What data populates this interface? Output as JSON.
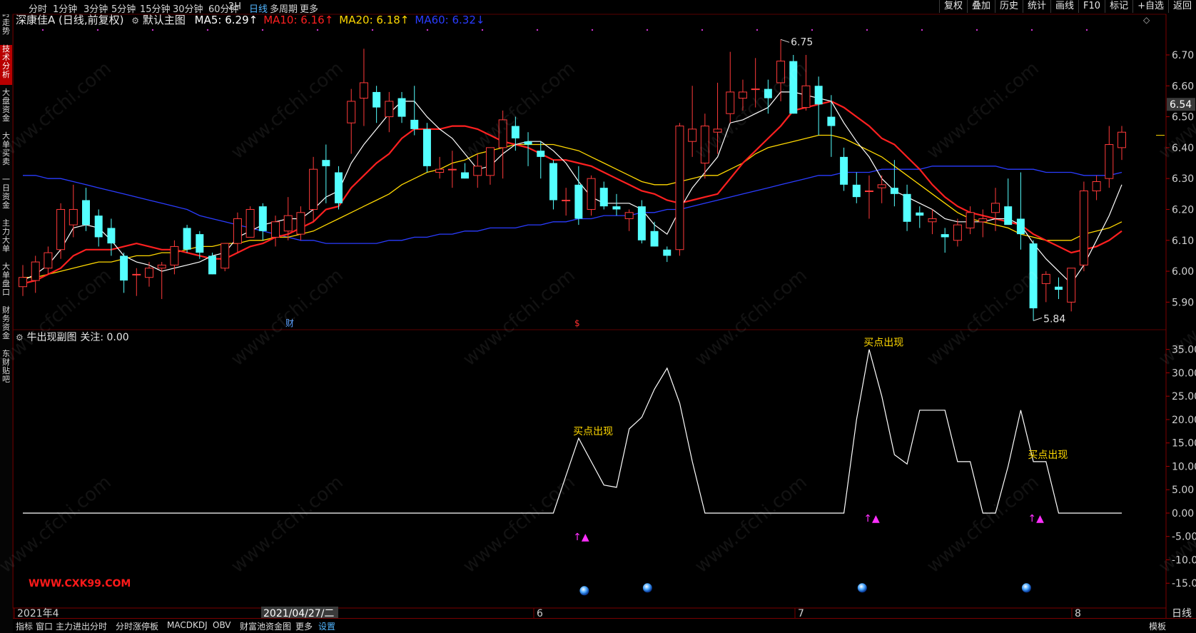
{
  "top_bar": {
    "periods": [
      "分时",
      "1分钟",
      "3分钟",
      "5分钟",
      "15分钟",
      "30分钟",
      "60分钟",
      "2H",
      "日线",
      "多周期",
      "更多"
    ],
    "active_period": "日线",
    "right_tools": [
      "复权",
      "叠加",
      "历史",
      "统计",
      "画线",
      "F10",
      "标记",
      "+自选",
      "返回"
    ]
  },
  "left_tabs": [
    {
      "label": "分时走势",
      "active": false
    },
    {
      "label": "技术分析",
      "active": true
    },
    {
      "label": "大盘资金",
      "active": false
    },
    {
      "label": "大单买卖",
      "active": false
    },
    {
      "label": "一日资金",
      "active": false
    },
    {
      "label": "主力大单",
      "active": false
    },
    {
      "label": "大单盘口",
      "active": false
    },
    {
      "label": "财务资金",
      "active": false
    },
    {
      "label": "东财贴吧",
      "active": false
    }
  ],
  "main_chart": {
    "stock_title": "深康佳A (日线,前复权)",
    "template_name": "默认主图",
    "ma": [
      {
        "label": "MA5: 6.29↑",
        "color": "#ffffff"
      },
      {
        "label": "MA10: 6.16↑",
        "color": "#ff2020"
      },
      {
        "label": "MA20: 6.18↑",
        "color": "#ffd800"
      },
      {
        "label": "MA60: 6.32↓",
        "color": "#2a3cff"
      }
    ],
    "current_price_tag": "6.54",
    "high_label": "6.75",
    "low_label": "5.84",
    "event_markers": [
      "财",
      "$"
    ],
    "y_ticks": [
      "6.70",
      "6.60",
      "6.50",
      "6.40",
      "6.30",
      "6.20",
      "6.10",
      "6.00",
      "5.90"
    ]
  },
  "sub_chart": {
    "title": "牛出现副图",
    "focus_label": "关注: 0.00",
    "signal_text": "买点出现",
    "arrow_text": "↑▲",
    "y_ticks": [
      "35.00",
      "30.00",
      "25.00",
      "20.00",
      "15.00",
      "10.00",
      "5.00",
      "0.00",
      "-5.00",
      "-10.00",
      "-15.00"
    ]
  },
  "x_axis": {
    "labels": [
      "2021年4",
      "6",
      "7",
      "8"
    ],
    "cursor_date": "2021/04/27/二",
    "period_label": "日线"
  },
  "bottom_tabs": {
    "items": [
      "指标",
      "窗口",
      "主力进出分时",
      "分时涨停板",
      "MACD",
      "KDJ",
      "OBV",
      "财富池资金图",
      "更多",
      "设置"
    ],
    "active": "设置",
    "template_label": "模板"
  },
  "watermarks": {
    "site": "www.cfchi.com",
    "red": "WWW.CXK99.COM"
  },
  "chart_data": {
    "type": "candlestick",
    "main_ylim": [
      5.82,
      6.79
    ],
    "ohlc": [
      [
        5.95,
        6.02,
        5.92,
        5.98
      ],
      [
        5.97,
        6.05,
        5.93,
        6.03
      ],
      [
        6.01,
        6.08,
        5.99,
        6.06
      ],
      [
        6.07,
        6.22,
        6.04,
        6.2
      ],
      [
        6.15,
        6.28,
        6.11,
        6.2
      ],
      [
        6.23,
        6.27,
        6.13,
        6.15
      ],
      [
        6.18,
        6.2,
        6.08,
        6.11
      ],
      [
        6.14,
        6.17,
        6.05,
        6.09
      ],
      [
        6.05,
        6.06,
        5.93,
        5.97
      ],
      [
        5.99,
        6.01,
        5.92,
        5.99
      ],
      [
        5.98,
        6.03,
        5.95,
        6.01
      ],
      [
        6.01,
        6.03,
        5.91,
        6.02
      ],
      [
        6.02,
        6.1,
        5.99,
        6.08
      ],
      [
        6.14,
        6.15,
        6.06,
        6.07
      ],
      [
        6.12,
        6.13,
        6.04,
        6.06
      ],
      [
        6.05,
        6.06,
        5.99,
        5.99
      ],
      [
        6.01,
        6.09,
        6.0,
        6.09
      ],
      [
        6.09,
        6.19,
        6.06,
        6.17
      ],
      [
        6.11,
        6.21,
        6.11,
        6.2
      ],
      [
        6.21,
        6.22,
        6.1,
        6.13
      ],
      [
        6.11,
        6.18,
        6.08,
        6.16
      ],
      [
        6.13,
        6.24,
        6.1,
        6.18
      ],
      [
        6.12,
        6.21,
        6.1,
        6.19
      ],
      [
        6.2,
        6.37,
        6.16,
        6.33
      ],
      [
        6.36,
        6.41,
        6.22,
        6.34
      ],
      [
        6.32,
        6.34,
        6.2,
        6.22
      ],
      [
        6.48,
        6.59,
        6.38,
        6.55
      ],
      [
        6.56,
        6.72,
        6.47,
        6.61
      ],
      [
        6.58,
        6.6,
        6.48,
        6.53
      ],
      [
        6.5,
        6.58,
        6.45,
        6.55
      ],
      [
        6.56,
        6.58,
        6.48,
        6.5
      ],
      [
        6.49,
        6.6,
        6.44,
        6.46
      ],
      [
        6.46,
        6.48,
        6.32,
        6.34
      ],
      [
        6.32,
        6.37,
        6.3,
        6.33
      ],
      [
        6.33,
        6.39,
        6.27,
        6.33
      ],
      [
        6.32,
        6.35,
        6.3,
        6.3
      ],
      [
        6.31,
        6.38,
        6.27,
        6.34
      ],
      [
        6.31,
        6.4,
        6.28,
        6.4
      ],
      [
        6.4,
        6.52,
        6.3,
        6.49
      ],
      [
        6.47,
        6.5,
        6.39,
        6.43
      ],
      [
        6.42,
        6.45,
        6.34,
        6.41
      ],
      [
        6.39,
        6.42,
        6.3,
        6.37
      ],
      [
        6.35,
        6.36,
        6.2,
        6.23
      ],
      [
        6.23,
        6.27,
        6.18,
        6.23
      ],
      [
        6.28,
        6.34,
        6.15,
        6.17
      ],
      [
        6.2,
        6.31,
        6.18,
        6.3
      ],
      [
        6.27,
        6.29,
        6.2,
        6.21
      ],
      [
        6.21,
        6.25,
        6.18,
        6.2
      ],
      [
        6.17,
        6.2,
        6.13,
        6.19
      ],
      [
        6.21,
        6.23,
        6.09,
        6.1
      ],
      [
        6.13,
        6.16,
        6.08,
        6.08
      ],
      [
        6.07,
        6.08,
        6.03,
        6.05
      ],
      [
        6.07,
        6.48,
        6.05,
        6.47
      ],
      [
        6.42,
        6.6,
        6.37,
        6.46
      ],
      [
        6.35,
        6.51,
        6.3,
        6.47
      ],
      [
        6.45,
        6.61,
        6.38,
        6.46
      ],
      [
        6.51,
        6.71,
        6.48,
        6.58
      ],
      [
        6.56,
        6.62,
        6.52,
        6.58
      ],
      [
        6.59,
        6.69,
        6.53,
        6.59
      ],
      [
        6.59,
        6.62,
        6.51,
        6.56
      ],
      [
        6.61,
        6.75,
        6.55,
        6.68
      ],
      [
        6.68,
        6.7,
        6.51,
        6.51
      ],
      [
        6.53,
        6.7,
        6.52,
        6.6
      ],
      [
        6.6,
        6.63,
        6.44,
        6.54
      ],
      [
        6.5,
        6.57,
        6.37,
        6.47
      ],
      [
        6.37,
        6.4,
        6.26,
        6.28
      ],
      [
        6.28,
        6.32,
        6.22,
        6.24
      ],
      [
        6.26,
        6.31,
        6.17,
        6.26
      ],
      [
        6.27,
        6.31,
        6.22,
        6.28
      ],
      [
        6.27,
        6.36,
        6.21,
        6.25
      ],
      [
        6.25,
        6.28,
        6.13,
        6.16
      ],
      [
        6.19,
        6.21,
        6.14,
        6.18
      ],
      [
        6.16,
        6.2,
        6.12,
        6.17
      ],
      [
        6.12,
        6.14,
        6.06,
        6.11
      ],
      [
        6.1,
        6.17,
        6.08,
        6.15
      ],
      [
        6.14,
        6.21,
        6.12,
        6.19
      ],
      [
        6.16,
        6.2,
        6.11,
        6.17
      ],
      [
        6.19,
        6.27,
        6.13,
        6.22
      ],
      [
        6.21,
        6.3,
        6.15,
        6.15
      ],
      [
        6.17,
        6.32,
        6.07,
        6.12
      ],
      [
        6.09,
        6.1,
        5.84,
        5.88
      ],
      [
        5.96,
        6.0,
        5.9,
        5.99
      ],
      [
        5.95,
        5.98,
        5.91,
        5.94
      ],
      [
        5.9,
        5.92,
        5.87,
        6.01
      ],
      [
        6.02,
        6.29,
        6.0,
        6.26
      ],
      [
        6.26,
        6.31,
        6.23,
        6.29
      ],
      [
        6.3,
        6.47,
        6.27,
        6.41
      ],
      [
        6.4,
        6.47,
        6.36,
        6.45
      ]
    ],
    "ma5": [
      5.97,
      5.99,
      6.02,
      6.07,
      6.14,
      6.15,
      6.14,
      6.1,
      6.05,
      6.03,
      6.02,
      6.0,
      6.01,
      6.02,
      6.03,
      6.05,
      6.06,
      6.11,
      6.13,
      6.15,
      6.16,
      6.17,
      6.17,
      6.2,
      6.24,
      6.26,
      6.35,
      6.41,
      6.46,
      6.51,
      6.55,
      6.55,
      6.5,
      6.46,
      6.43,
      6.38,
      6.33,
      6.34,
      6.38,
      6.41,
      6.42,
      6.42,
      6.39,
      6.35,
      6.29,
      6.24,
      6.22,
      6.22,
      6.22,
      6.2,
      6.15,
      6.12,
      6.2,
      6.27,
      6.32,
      6.37,
      6.48,
      6.49,
      6.51,
      6.53,
      6.58,
      6.58,
      6.57,
      6.56,
      6.55,
      6.48,
      6.42,
      6.37,
      6.3,
      6.26,
      6.24,
      6.22,
      6.2,
      6.17,
      6.16,
      6.16,
      6.16,
      6.17,
      6.17,
      6.15,
      6.09,
      6.04,
      6.0,
      5.96,
      6.02,
      6.1,
      6.18,
      6.28
    ],
    "ma10": [
      5.96,
      5.97,
      5.99,
      6.01,
      6.05,
      6.07,
      6.07,
      6.07,
      6.08,
      6.09,
      6.08,
      6.07,
      6.07,
      6.06,
      6.05,
      6.04,
      6.04,
      6.06,
      6.08,
      6.09,
      6.11,
      6.12,
      6.14,
      6.16,
      6.2,
      6.21,
      6.27,
      6.31,
      6.35,
      6.38,
      6.43,
      6.46,
      6.46,
      6.46,
      6.47,
      6.47,
      6.46,
      6.44,
      6.42,
      6.41,
      6.4,
      6.38,
      6.36,
      6.36,
      6.35,
      6.34,
      6.32,
      6.3,
      6.28,
      6.26,
      6.25,
      6.23,
      6.22,
      6.23,
      6.24,
      6.25,
      6.3,
      6.35,
      6.39,
      6.43,
      6.47,
      6.52,
      6.53,
      6.54,
      6.55,
      6.53,
      6.5,
      6.47,
      6.43,
      6.41,
      6.37,
      6.33,
      6.28,
      6.24,
      6.21,
      6.19,
      6.18,
      6.17,
      6.16,
      6.15,
      6.12,
      6.1,
      6.08,
      6.06,
      6.07,
      6.08,
      6.1,
      6.13
    ],
    "ma20": [
      5.98,
      5.98,
      5.99,
      6.0,
      6.01,
      6.02,
      6.03,
      6.03,
      6.04,
      6.05,
      6.05,
      6.06,
      6.06,
      6.07,
      6.08,
      6.08,
      6.09,
      6.09,
      6.1,
      6.1,
      6.11,
      6.11,
      6.12,
      6.13,
      6.15,
      6.17,
      6.19,
      6.21,
      6.23,
      6.25,
      6.28,
      6.3,
      6.32,
      6.33,
      6.35,
      6.36,
      6.38,
      6.39,
      6.4,
      6.41,
      6.41,
      6.41,
      6.41,
      6.4,
      6.39,
      6.37,
      6.35,
      6.33,
      6.31,
      6.29,
      6.28,
      6.28,
      6.29,
      6.3,
      6.31,
      6.31,
      6.33,
      6.35,
      6.38,
      6.4,
      6.41,
      6.42,
      6.43,
      6.44,
      6.44,
      6.43,
      6.41,
      6.39,
      6.37,
      6.34,
      6.31,
      6.28,
      6.25,
      6.22,
      6.19,
      6.17,
      6.16,
      6.15,
      6.14,
      6.12,
      6.11,
      6.1,
      6.1,
      6.1,
      6.12,
      6.13,
      6.14,
      6.16
    ],
    "ma60": [
      6.31,
      6.31,
      6.3,
      6.3,
      6.29,
      6.28,
      6.27,
      6.26,
      6.25,
      6.24,
      6.23,
      6.22,
      6.21,
      6.2,
      6.18,
      6.17,
      6.16,
      6.15,
      6.14,
      6.13,
      6.12,
      6.11,
      6.1,
      6.1,
      6.09,
      6.09,
      6.09,
      6.09,
      6.09,
      6.1,
      6.1,
      6.11,
      6.11,
      6.12,
      6.12,
      6.13,
      6.13,
      6.14,
      6.14,
      6.14,
      6.15,
      6.15,
      6.16,
      6.16,
      6.17,
      6.17,
      6.18,
      6.18,
      6.18,
      6.19,
      6.19,
      6.2,
      6.2,
      6.21,
      6.22,
      6.23,
      6.24,
      6.25,
      6.26,
      6.27,
      6.28,
      6.29,
      6.3,
      6.31,
      6.31,
      6.32,
      6.32,
      6.32,
      6.33,
      6.33,
      6.33,
      6.33,
      6.34,
      6.34,
      6.34,
      6.34,
      6.34,
      6.34,
      6.33,
      6.33,
      6.33,
      6.32,
      6.32,
      6.32,
      6.31,
      6.31,
      6.31,
      6.32
    ],
    "sub_ylim": [
      -20,
      38
    ],
    "indicator": [
      0,
      0,
      0,
      0,
      0,
      0,
      0,
      0,
      0,
      0,
      0,
      0,
      0,
      0,
      0,
      0,
      0,
      0,
      0,
      0,
      0,
      0,
      0,
      0,
      0,
      0,
      0,
      0,
      0,
      0,
      0,
      0,
      0,
      0,
      0,
      0,
      0,
      0,
      0,
      0,
      0,
      0,
      0,
      8,
      16,
      11,
      6,
      5.5,
      18,
      20.5,
      26.5,
      31,
      23.5,
      11,
      0,
      0,
      0,
      0,
      0,
      0,
      0,
      0,
      0,
      0,
      0,
      0,
      20,
      35,
      25,
      12.5,
      10.5,
      22,
      22,
      22,
      11,
      11,
      0,
      0,
      10,
      22,
      11,
      11,
      0,
      0,
      0,
      0,
      0,
      0
    ],
    "signals": [
      43,
      66,
      79
    ],
    "balls": [
      44,
      49,
      66,
      79
    ]
  }
}
